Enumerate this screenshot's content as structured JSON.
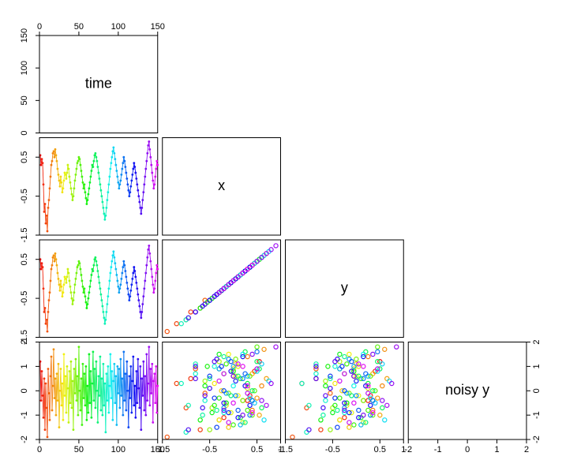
{
  "chart_data": {
    "type": "scatter",
    "matrix_type": "pairs",
    "variables": [
      "time",
      "x",
      "y",
      "noisy y"
    ],
    "panel_labels": [
      "time",
      "x",
      "y",
      "noisy y"
    ],
    "axis_ranges": {
      "time": [
        0,
        150
      ],
      "x": [
        -1.5,
        1.0
      ],
      "y": [
        -1.5,
        1.0
      ],
      "noisy_y": [
        -2,
        2
      ]
    },
    "ticks": {
      "time_top": [
        0,
        50,
        100,
        150
      ],
      "time_left": [
        0,
        50,
        100,
        150
      ],
      "x_left": [
        -1.5,
        -0.5,
        0.5
      ],
      "x_bottom": [
        -1.5,
        -0.5,
        0.5,
        1.0
      ],
      "y_left": [
        -1.5,
        -0.5,
        0.5
      ],
      "y_bottom": [
        -1.5,
        -0.5,
        0.5,
        1.0
      ],
      "noisy_y_left": [
        -2,
        -1,
        0,
        1,
        2
      ],
      "noisy_y_right": [
        -2,
        -1,
        0,
        1,
        2
      ],
      "noisy_y_bottom": [
        -2,
        -1,
        0,
        1,
        2
      ]
    },
    "colors_scheme": "rainbow_by_time",
    "series": [
      {
        "name": "dataset",
        "n": 150,
        "time": [
          1,
          2,
          3,
          4,
          5,
          6,
          7,
          8,
          9,
          10,
          11,
          12,
          13,
          14,
          15,
          16,
          17,
          18,
          19,
          20,
          21,
          22,
          23,
          24,
          25,
          26,
          27,
          28,
          29,
          30,
          31,
          32,
          33,
          34,
          35,
          36,
          37,
          38,
          39,
          40,
          41,
          42,
          43,
          44,
          45,
          46,
          47,
          48,
          49,
          50,
          51,
          52,
          53,
          54,
          55,
          56,
          57,
          58,
          59,
          60,
          61,
          62,
          63,
          64,
          65,
          66,
          67,
          68,
          69,
          70,
          71,
          72,
          73,
          74,
          75,
          76,
          77,
          78,
          79,
          80,
          81,
          82,
          83,
          84,
          85,
          86,
          87,
          88,
          89,
          90,
          91,
          92,
          93,
          94,
          95,
          96,
          97,
          98,
          99,
          100,
          101,
          102,
          103,
          104,
          105,
          106,
          107,
          108,
          109,
          110,
          111,
          112,
          113,
          114,
          115,
          116,
          117,
          118,
          119,
          120,
          121,
          122,
          123,
          124,
          125,
          126,
          127,
          128,
          129,
          130,
          131,
          132,
          133,
          134,
          135,
          136,
          137,
          138,
          139,
          140,
          141,
          142,
          143,
          144,
          145,
          146,
          147,
          148,
          149,
          150
        ],
        "x": [
          0.55,
          0.3,
          0.45,
          0.35,
          -0.2,
          -0.9,
          -0.7,
          -1.2,
          -1.0,
          -1.4,
          -0.8,
          -0.6,
          -0.3,
          0.0,
          0.3,
          0.4,
          0.6,
          0.65,
          0.5,
          0.7,
          0.55,
          0.4,
          0.2,
          0.05,
          -0.1,
          -0.25,
          0.0,
          -0.15,
          -0.4,
          -0.3,
          -0.1,
          0.1,
          0.05,
          -0.05,
          0.1,
          0.3,
          0.2,
          0.0,
          -0.15,
          -0.3,
          -0.45,
          -0.6,
          -0.5,
          -0.3,
          -0.1,
          0.05,
          0.2,
          0.35,
          0.4,
          0.5,
          0.45,
          0.3,
          0.15,
          0.0,
          -0.15,
          -0.3,
          -0.2,
          -0.4,
          -0.55,
          -0.7,
          -0.6,
          -0.45,
          -0.3,
          -0.15,
          0.0,
          0.15,
          0.3,
          0.25,
          0.4,
          0.55,
          0.6,
          0.5,
          0.4,
          0.25,
          0.1,
          -0.05,
          -0.2,
          -0.35,
          -0.5,
          -0.65,
          -0.8,
          -0.95,
          -1.1,
          -1.0,
          -0.8,
          -0.6,
          -0.4,
          -0.2,
          0.0,
          0.2,
          0.35,
          0.5,
          0.65,
          0.75,
          0.6,
          0.45,
          0.3,
          0.15,
          0.0,
          -0.15,
          -0.3,
          -0.2,
          -0.1,
          0.05,
          0.2,
          0.35,
          0.5,
          0.4,
          0.25,
          0.1,
          -0.05,
          -0.2,
          -0.35,
          -0.5,
          -0.4,
          -0.25,
          -0.1,
          0.05,
          0.2,
          0.35,
          0.25,
          0.1,
          -0.05,
          -0.2,
          -0.35,
          -0.5,
          -0.65,
          -0.8,
          -0.95,
          -0.8,
          -0.6,
          -0.4,
          -0.2,
          0.0,
          0.2,
          0.4,
          0.6,
          0.8,
          0.9,
          0.7,
          0.5,
          0.3,
          0.1,
          -0.1,
          -0.3,
          -0.2,
          0.0,
          0.2,
          0.4,
          0.3
        ],
        "y": [
          0.5,
          0.25,
          0.4,
          0.3,
          -0.25,
          -0.85,
          -0.75,
          -1.15,
          -1.05,
          -1.35,
          -0.85,
          -0.55,
          -0.35,
          -0.05,
          0.25,
          0.35,
          0.55,
          0.6,
          0.45,
          0.65,
          0.5,
          0.35,
          0.15,
          0.0,
          -0.15,
          -0.3,
          -0.05,
          -0.2,
          -0.45,
          -0.35,
          -0.15,
          0.05,
          0.0,
          -0.1,
          0.05,
          0.25,
          0.15,
          -0.05,
          -0.2,
          -0.35,
          -0.5,
          -0.65,
          -0.55,
          -0.35,
          -0.15,
          0.0,
          0.15,
          0.3,
          0.35,
          0.45,
          0.4,
          0.25,
          0.1,
          -0.05,
          -0.2,
          -0.35,
          -0.25,
          -0.45,
          -0.6,
          -0.75,
          -0.65,
          -0.5,
          -0.35,
          -0.2,
          -0.05,
          0.1,
          0.25,
          0.2,
          0.35,
          0.5,
          0.55,
          0.45,
          0.35,
          0.2,
          0.05,
          -0.1,
          -0.25,
          -0.4,
          -0.55,
          -0.7,
          -0.85,
          -1.0,
          -1.15,
          -1.05,
          -0.85,
          -0.65,
          -0.45,
          -0.25,
          -0.05,
          0.15,
          0.3,
          0.45,
          0.6,
          0.7,
          0.55,
          0.4,
          0.25,
          0.1,
          -0.05,
          -0.2,
          -0.35,
          -0.25,
          -0.15,
          0.0,
          0.15,
          0.3,
          0.45,
          0.35,
          0.2,
          0.05,
          -0.1,
          -0.25,
          -0.4,
          -0.55,
          -0.45,
          -0.3,
          -0.15,
          0.0,
          0.15,
          0.3,
          0.2,
          0.05,
          -0.1,
          -0.25,
          -0.4,
          -0.55,
          -0.7,
          -0.85,
          -1.0,
          -0.85,
          -0.65,
          -0.45,
          -0.25,
          -0.05,
          0.15,
          0.35,
          0.55,
          0.75,
          0.85,
          0.65,
          0.45,
          0.25,
          0.05,
          -0.15,
          -0.35,
          -0.25,
          -0.05,
          0.15,
          0.35,
          0.25
        ],
        "noisy_y": [
          1.2,
          -0.4,
          0.8,
          -0.2,
          -1.1,
          0.5,
          -1.6,
          0.3,
          -0.7,
          -1.9,
          0.9,
          -0.1,
          -1.2,
          0.6,
          1.4,
          -0.8,
          0.2,
          1.7,
          -0.3,
          0.5,
          -1.0,
          0.7,
          -0.4,
          1.1,
          -1.5,
          0.0,
          0.9,
          -0.6,
          0.3,
          -1.2,
          1.5,
          -0.2,
          0.6,
          -0.9,
          1.0,
          0.1,
          -1.3,
          0.8,
          -0.5,
          1.2,
          -0.7,
          0.4,
          -1.6,
          0.9,
          -0.1,
          1.3,
          -0.4,
          0.6,
          -1.0,
          1.8,
          0.0,
          -0.8,
          0.5,
          -1.4,
          1.1,
          -0.3,
          0.7,
          -0.6,
          1.0,
          -1.2,
          0.2,
          -0.9,
          1.5,
          -0.5,
          0.8,
          -1.1,
          0.3,
          1.6,
          -0.4,
          0.9,
          -0.7,
          1.2,
          0.0,
          -1.3,
          0.6,
          -0.2,
          1.4,
          -0.8,
          0.5,
          -1.0,
          1.1,
          -0.6,
          0.3,
          -1.7,
          0.7,
          -0.4,
          1.0,
          -0.9,
          0.2,
          1.5,
          -0.3,
          0.8,
          -1.2,
          0.4,
          1.1,
          -0.5,
          0.6,
          -1.4,
          1.0,
          -0.1,
          0.9,
          -0.7,
          1.3,
          -0.2,
          0.5,
          -1.0,
          1.6,
          -0.4,
          0.7,
          -0.8,
          1.2,
          0.0,
          -1.5,
          0.6,
          -0.3,
          1.0,
          -0.9,
          0.4,
          1.4,
          -0.6,
          0.2,
          -1.1,
          0.8,
          -0.5,
          1.3,
          0.1,
          -0.7,
          1.0,
          -1.6,
          0.5,
          -0.2,
          1.2,
          -0.8,
          0.6,
          -1.0,
          1.5,
          -0.4,
          0.3,
          1.8,
          -0.6,
          0.9,
          -0.1,
          1.1,
          -1.3,
          0.4,
          0.7,
          -0.5,
          1.0,
          -0.9,
          0.2
        ]
      }
    ]
  }
}
